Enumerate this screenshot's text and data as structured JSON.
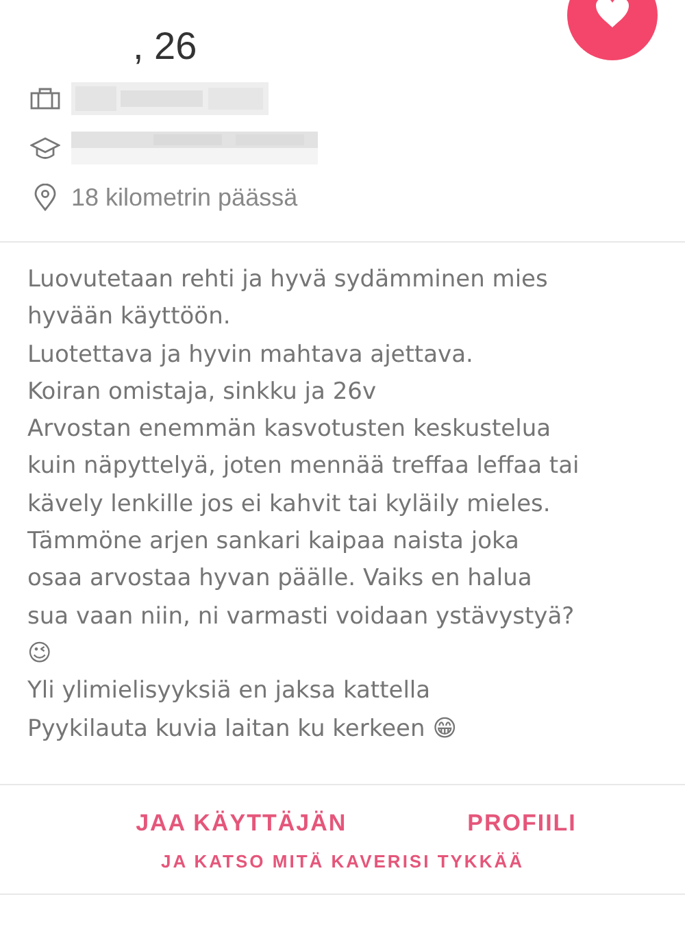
{
  "profile": {
    "age_text": ", 26",
    "distance": "18 kilometrin päässä"
  },
  "bio_lines": [
    "Luovutetaan rehti ja hyvä sydämminen mies",
    "hyvään käyttöön.",
    "Luotettava ja hyvin mahtava ajettava.",
    "Koiran omistaja, sinkku ja 26v",
    "Arvostan enemmän kasvotusten keskustelua",
    "kuin näpyttelyä, joten mennää treffaa leffaa tai",
    "kävely lenkille jos ei kahvit tai kyläily mieles.",
    "Tämmöne arjen sankari kaipaa naista joka",
    "osaa arvostaa hyvan päälle. Vaiks en halua",
    "sua vaan niin, ni varmasti voidaan ystävystyä?",
    "😉",
    "Yli ylimielisyyksiä en jaksa kattella",
    "Pyykilauta kuvia laitan ku kerkeen 😁"
  ],
  "share_button": {
    "part_1": "JAA KÄYTTÄJÄN",
    "part_2": "PROFIILI",
    "subtitle": "JA KATSO MITÄ KAVERISI TYKKÄÄ"
  }
}
